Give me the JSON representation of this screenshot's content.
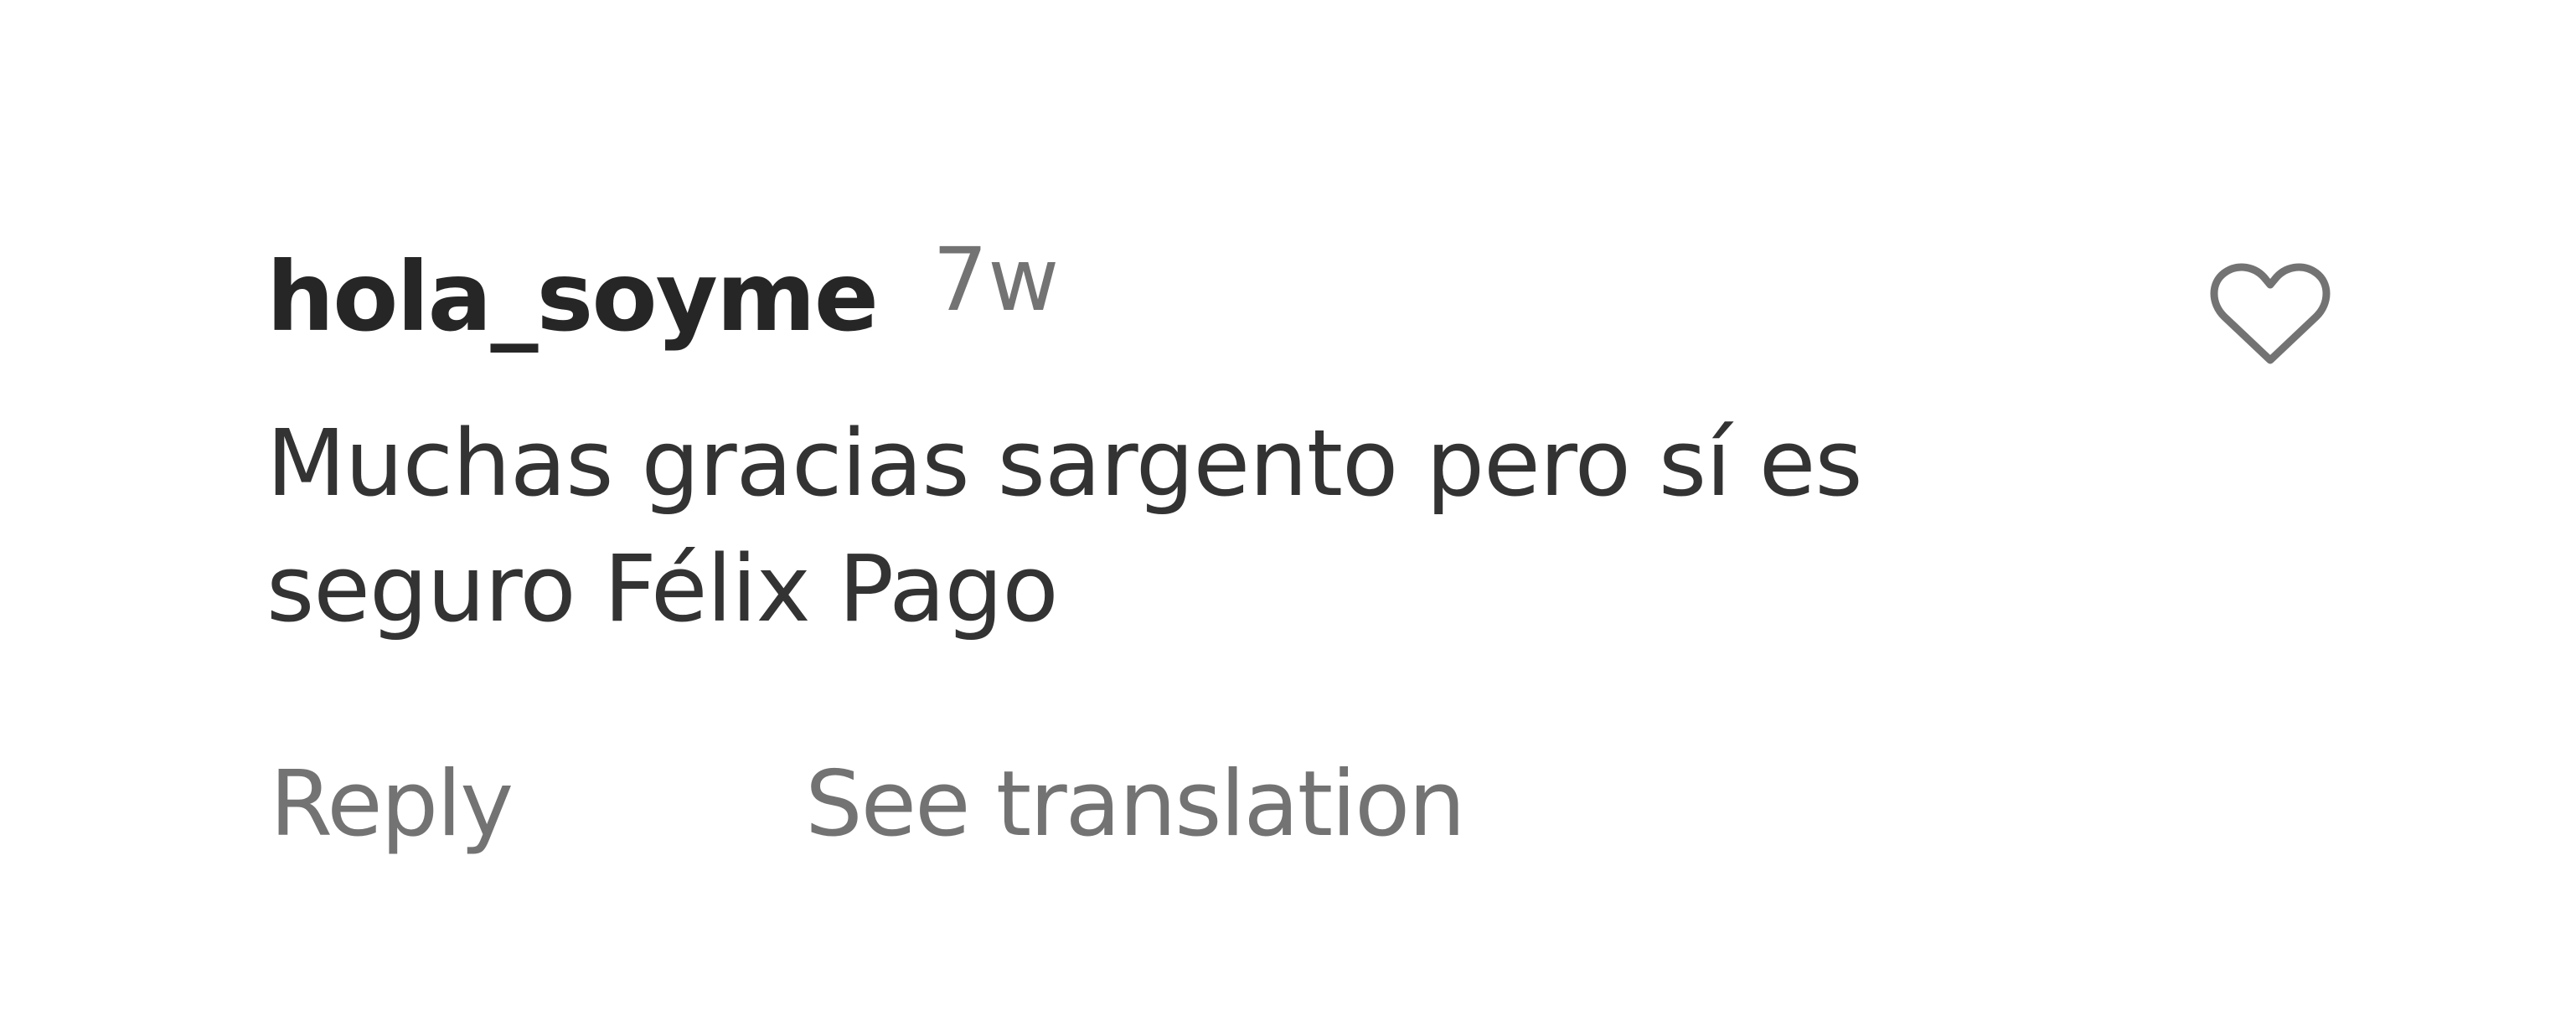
{
  "comment": {
    "username": "hola_soyme",
    "timestamp": "7w",
    "text": "Muchas gracias sargento pero sí es seguro Félix Pago",
    "actions": {
      "reply_label": "Reply",
      "translate_label": "See translation"
    },
    "like_icon": "heart-outline-icon"
  },
  "colors": {
    "username": "#262626",
    "secondary_text": "#737373",
    "body_text": "#333333",
    "icon_stroke": "#737373",
    "background": "#ffffff"
  }
}
